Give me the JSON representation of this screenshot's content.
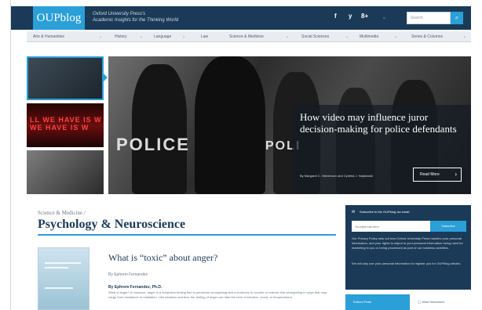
{
  "header": {
    "logo": "OUPblog",
    "tagline_line1": "Oxford University Press's",
    "tagline_line2": "Academic Insights for the Thinking World",
    "social": [
      "f",
      "y",
      "8+"
    ],
    "search_placeholder": "Search"
  },
  "nav": {
    "items": [
      "Arts & Humanities",
      "History",
      "Language",
      "Law",
      "Science & Medicine",
      "Social Sciences",
      "Multimedia",
      "Series & Columns"
    ]
  },
  "hero": {
    "thumb2_text": "LL WE HAVE IS W\nWE HAVE IS W",
    "police_word_1": "POLICE",
    "police_word_2": "POLI",
    "title": "How video may influence juror decision-making for police defendants",
    "byline": "By Margaret C. Stevenson and Cynthia J. Najdowski",
    "read_more": "Read More"
  },
  "section": {
    "breadcrumb": "Science & Medicine /",
    "title": "Psychology & Neuroscience"
  },
  "article": {
    "title": "What is “toxic” about anger?",
    "author": "By Ephrem Fernandez",
    "excerpt_head": "By Ephrem Fernandez, Ph.D.",
    "excerpt": "What is anger? In essence, anger is a subjective feeling tied to perceived wrongdoing and a tendency to counter or redress that wrongdoing in ways that may range from resistance to retaliation. Like sadness and fear, the feeling of anger can take the form of emotion, mood, or temperament."
  },
  "subscribe": {
    "heading": "Subscribe to the OUPblog via email:",
    "input_placeholder": "Your@email.here",
    "button": "Subscribe",
    "text1": "Our Privacy Policy sets out how Oxford University Press handles your personal information, and your rights to object to your personal information being used for marketing to you or being processed as part of our business activities.",
    "text2": "We will only use your personal information to register you for OUPblog articles."
  },
  "tabs": {
    "editors": "Editors Picks",
    "most": "Most Discussed"
  },
  "colors": {
    "brand_dark": "#1b3a57",
    "accent": "#2a9fd8"
  }
}
